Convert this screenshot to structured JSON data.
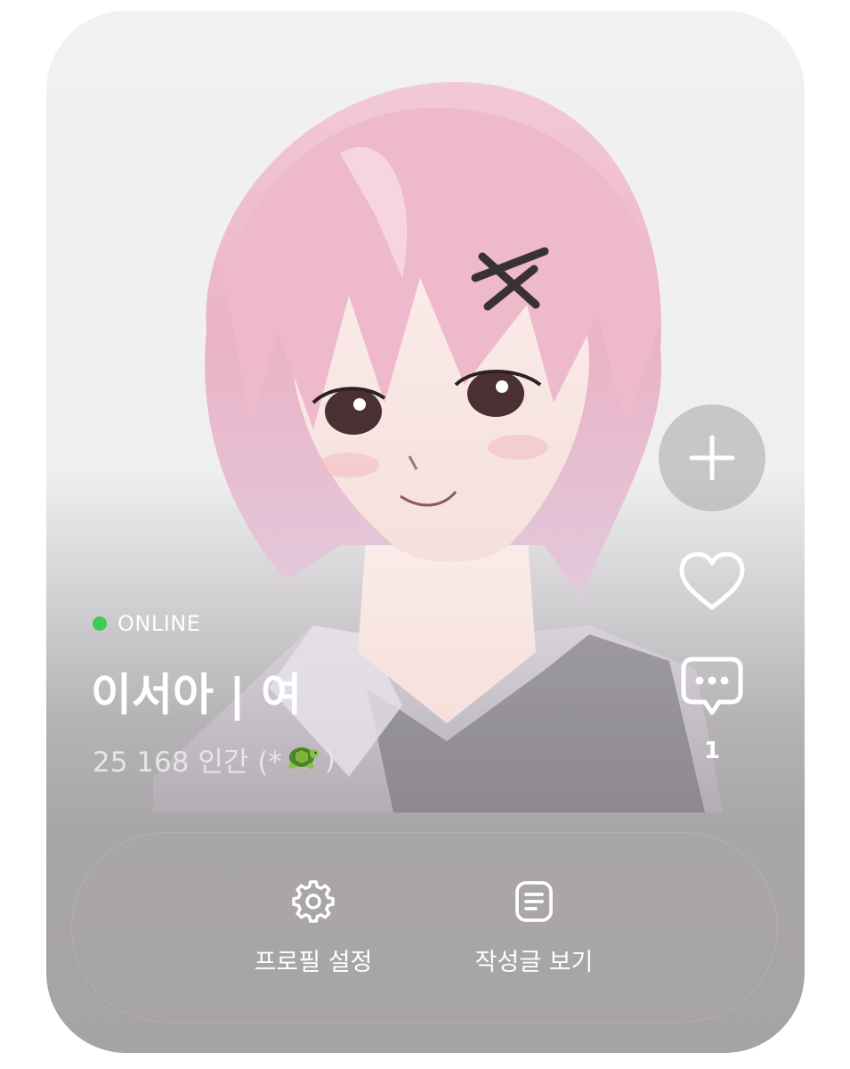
{
  "profile": {
    "status": "ONLINE",
    "status_color": "#3ccb54",
    "name": "이서아 | 여",
    "bio_text": "25 168 인간 (*",
    "bio_emoji": "turtle-emoji",
    "bio_close": ")"
  },
  "side_actions": {
    "add_icon": "plus-icon",
    "like_icon": "heart-icon",
    "comment_icon": "chat-bubble-icon",
    "comment_count": "1"
  },
  "action_bar": {
    "settings": {
      "label": "프로필 설정",
      "icon": "gear-icon"
    },
    "posts": {
      "label": "작성글 보기",
      "icon": "document-icon"
    }
  }
}
